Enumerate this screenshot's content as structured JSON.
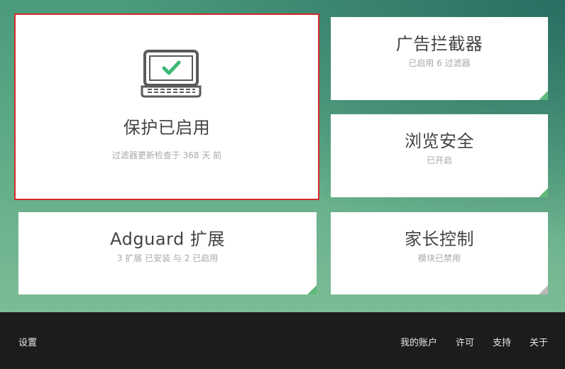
{
  "tiles": {
    "protection": {
      "title": "保护已启用",
      "subtitle": "过滤器更新检查于 368 天 前",
      "icon": "laptop-check-icon",
      "accent": "#3cb878"
    },
    "adblock": {
      "title": "广告拦截器",
      "subtitle": "已启用 6 过滤器"
    },
    "browsing": {
      "title": "浏览安全",
      "subtitle": "已开启"
    },
    "extensions": {
      "title": "Adguard 扩展",
      "subtitle": "3 扩展 已安装 与 2 已启用"
    },
    "parental": {
      "title": "家长控制",
      "subtitle": "模块已禁用"
    }
  },
  "footer": {
    "settings": "设置",
    "account": "我的账户",
    "license": "许可",
    "support": "支持",
    "about": "关于"
  },
  "colors": {
    "highlight_border": "#d52b2b",
    "corner_enabled": "#5fb878",
    "corner_disabled": "#b8b8b8",
    "footer_bg": "#1c1c1c"
  }
}
